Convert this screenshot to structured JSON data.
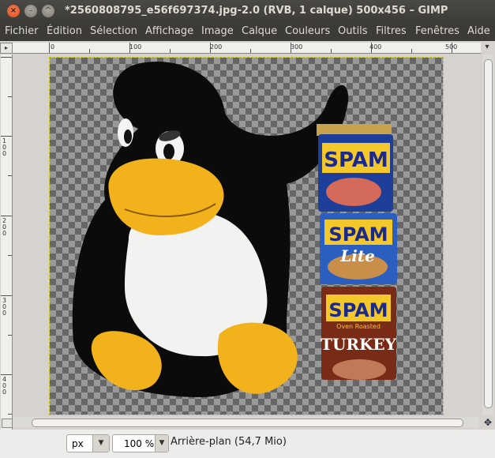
{
  "window": {
    "title": "*2560808795_e56f697374.jpg-2.0 (RVB, 1 calque) 500x456 – GIMP",
    "close_icon": "×",
    "minimize_icon": "–",
    "maximize_icon": "^"
  },
  "menu": [
    "Fichier",
    "Édition",
    "Sélection",
    "Affichage",
    "Image",
    "Calque",
    "Couleurs",
    "Outils",
    "Filtres",
    "Fenêtres",
    "Aide"
  ],
  "rulers": {
    "horizontal": [
      "0",
      "100",
      "200",
      "300",
      "400",
      "500"
    ],
    "vertical": [
      "1\n0\n0",
      "2\n0\n0",
      "3\n0\n0",
      "4\n0\n0"
    ]
  },
  "image": {
    "can_labels": [
      "SPAM",
      "SPAM",
      "Lite",
      "SPAM",
      "Oven Roasted",
      "TURKEY"
    ]
  },
  "status": {
    "unit": "px",
    "zoom": "100 %",
    "layer_info": "Arrière-plan (54,7 Mio)"
  },
  "colors": {
    "selection_border": "#c8c400",
    "title_bar": "#3c3b37",
    "close_button": "#df4a16"
  },
  "icons": [
    "close-icon",
    "minimize-icon",
    "maximize-icon",
    "navigate-icon",
    "move-icon",
    "quick-mask-icon",
    "dropdown-arrow-icon"
  ]
}
